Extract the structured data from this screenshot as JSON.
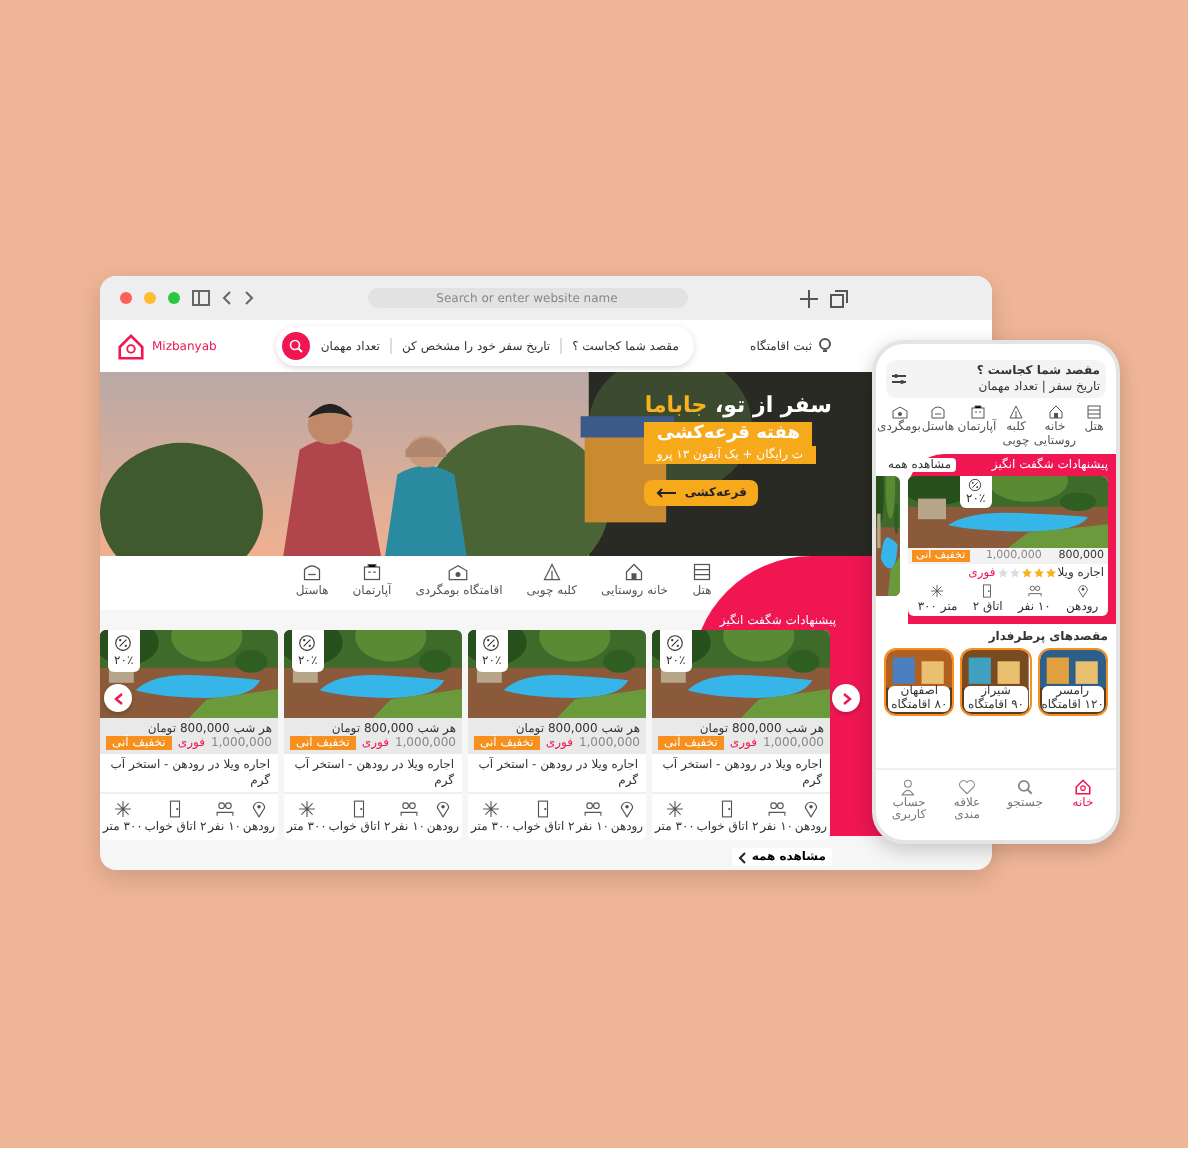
{
  "browser": {
    "address_placeholder": "Search or enter website name"
  },
  "site": {
    "logo": "Mizbanyab",
    "register": "ثبت اقامتگاه",
    "search": [
      "مقصد شما کجاست ؟",
      "تاریخ سفر خود را مشخص کن",
      "تعداد مهمان"
    ]
  },
  "banner": {
    "headline": "سفر از تو، ",
    "headline_brand": "جاباما",
    "promo_title": "هفته قرعه‌کشی",
    "promo_subtitle": "ت رایگان + یک آیفون ۱۳ پرو",
    "button": "قرعه‌کشی"
  },
  "categories": [
    {
      "kind": "hotel",
      "label": "هتل"
    },
    {
      "kind": "house",
      "label": "خانه روستایی"
    },
    {
      "kind": "cabin",
      "label": "کلبه چوبی"
    },
    {
      "kind": "eco",
      "label": "اقامتگاه بومگردی"
    },
    {
      "kind": "apartment",
      "label": "آپارتمان"
    },
    {
      "kind": "hostel",
      "label": "هاستل"
    }
  ],
  "offers": {
    "title": "پیشنهادات شگفت انگیز",
    "see_all": "مشاهده همه",
    "cards": [
      {
        "discount": "۲۰٪",
        "price_label": "هر شب",
        "price": "800,000",
        "currency": "تومان",
        "old_price": "1,000,000",
        "badge": "تخفیف آنی",
        "urgent": "فوری",
        "title": "اجاره ویلا در رودهن - استخر آب گرم",
        "features": [
          {
            "kind": "location",
            "label": "رودهن"
          },
          {
            "kind": "guests",
            "label": "۱۰ نفر"
          },
          {
            "kind": "room",
            "label": "۲ اتاق خواب"
          },
          {
            "kind": "area",
            "label": "۳۰۰ متر"
          }
        ]
      },
      {
        "discount": "۲۰٪",
        "price_label": "هر شب",
        "price": "800,000",
        "currency": "تومان",
        "old_price": "1,000,000",
        "badge": "تخفیف آنی",
        "urgent": "فوری",
        "title": "اجاره ویلا در رودهن - استخر آب گرم",
        "features": [
          {
            "kind": "location",
            "label": "رودهن"
          },
          {
            "kind": "guests",
            "label": "۱۰ نفر"
          },
          {
            "kind": "room",
            "label": "۲ اتاق خواب"
          },
          {
            "kind": "area",
            "label": "۳۰۰ متر"
          }
        ]
      },
      {
        "discount": "۲۰٪",
        "price_label": "هر شب",
        "price": "800,000",
        "currency": "تومان",
        "old_price": "1,000,000",
        "badge": "تخفیف آنی",
        "urgent": "فوری",
        "title": "اجاره ویلا در رودهن - استخر آب گرم",
        "features": [
          {
            "kind": "location",
            "label": "رودهن"
          },
          {
            "kind": "guests",
            "label": "۱۰ نفر"
          },
          {
            "kind": "room",
            "label": "۲ اتاق خواب"
          },
          {
            "kind": "area",
            "label": "۳۰۰ متر"
          }
        ]
      },
      {
        "discount": "۲۰٪",
        "price_label": "هر شب",
        "price": "800,000",
        "currency": "تومان",
        "old_price": "1,000,000",
        "badge": "تخفیف آنی",
        "urgent": "فوری",
        "title": "اجاره ویلا در رودهن - استخر آب گرم",
        "features": [
          {
            "kind": "location",
            "label": "رودهن"
          },
          {
            "kind": "guests",
            "label": "۱۰ نفر"
          },
          {
            "kind": "room",
            "label": "۲ اتاق خواب"
          },
          {
            "kind": "area",
            "label": "۳۰۰ متر"
          }
        ]
      }
    ]
  },
  "phone": {
    "search_title": "مقصد شما کجاست ؟",
    "search_subtitle": "تاریخ سفر | تعداد مهمان",
    "categories": [
      {
        "kind": "hotel",
        "label": "هتل"
      },
      {
        "kind": "house",
        "label": "خانه روستایی"
      },
      {
        "kind": "cabin",
        "label": "کلبه چوبی"
      },
      {
        "kind": "apartment",
        "label": "آپارتمان"
      },
      {
        "kind": "hostel",
        "label": "هاستل"
      },
      {
        "kind": "eco",
        "label": "بومگردی"
      }
    ],
    "offers_title": "پیشنهادات شگفت انگیز",
    "see_all": "مشاهده همه",
    "card": {
      "discount": "۲۰٪",
      "price": "800,000",
      "old_price": "1,000,000",
      "badge": "تخفیف آنی",
      "urgent": "فوری",
      "title": "اجاره ویلا",
      "stars": 3,
      "features": [
        {
          "kind": "location",
          "label": "رودهن"
        },
        {
          "kind": "guests",
          "label": "۱۰ نفر"
        },
        {
          "kind": "room",
          "label": "اتاق ۲"
        },
        {
          "kind": "area",
          "label": "متر ۳۰۰"
        }
      ]
    },
    "cities_title": "مقصدهای پرطرفدار",
    "cities": [
      {
        "name": "رامسر",
        "count": "۱۲۰ اقامتگاه"
      },
      {
        "name": "شیراز",
        "count": "۹۰ اقامتگاه"
      },
      {
        "name": "اصفهان",
        "count": "۸۰ اقامتگاه"
      }
    ],
    "nav": [
      {
        "kind": "home",
        "label": "خانه",
        "selected": true
      },
      {
        "kind": "search",
        "label": "جستجو",
        "selected": false
      },
      {
        "kind": "heart",
        "label": "علاقه مندی",
        "selected": false
      },
      {
        "kind": "account",
        "label": "حساب کاربری",
        "selected": false
      }
    ]
  }
}
